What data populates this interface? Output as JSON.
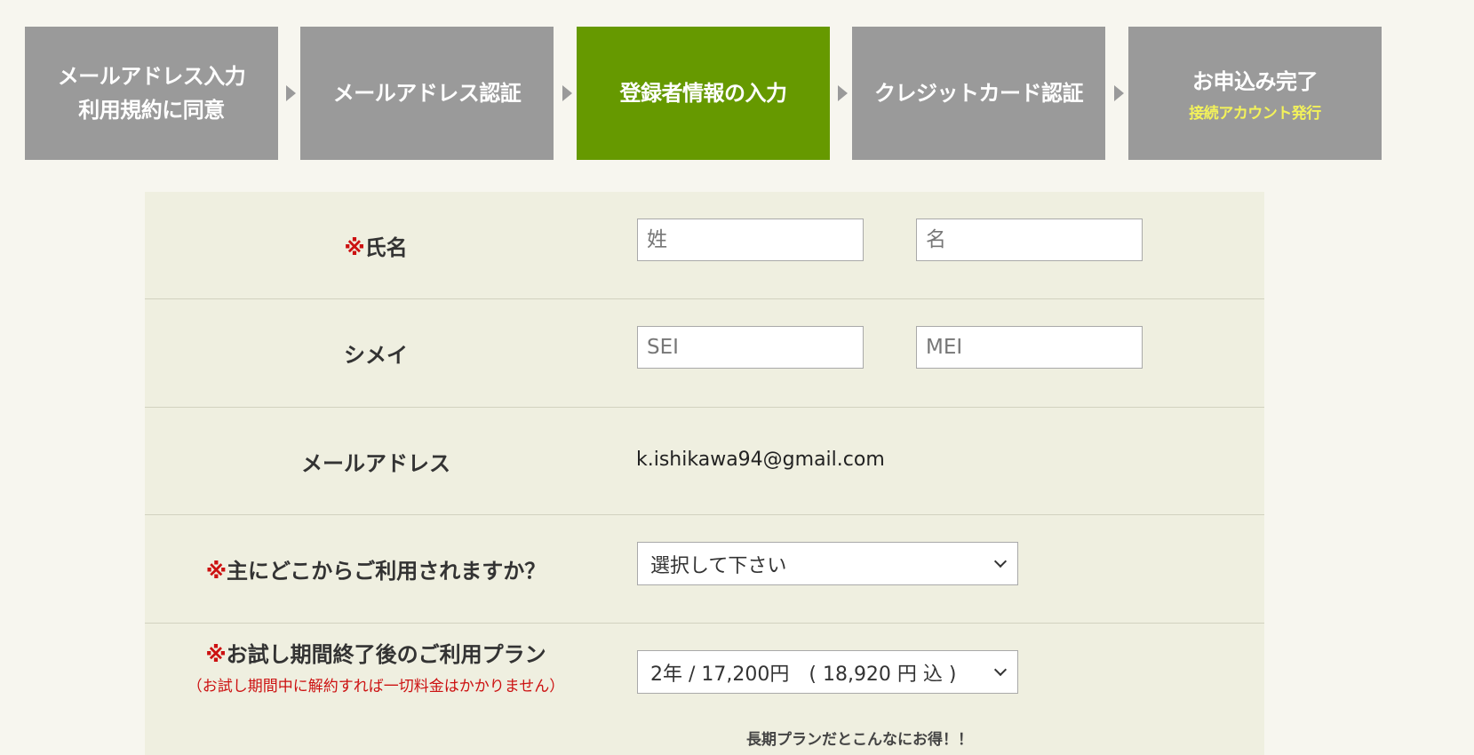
{
  "steps": [
    {
      "label": "メールアドレス入力\n利用規約に同意",
      "sub": ""
    },
    {
      "label": "メールアドレス認証",
      "sub": ""
    },
    {
      "label": "登録者情報の入力",
      "sub": ""
    },
    {
      "label": "クレジットカード認証",
      "sub": ""
    },
    {
      "label": "お申込み完了",
      "sub": "接続アカウント発行"
    }
  ],
  "colors": {
    "step_inactive": "#9a9a9a",
    "step_active": "#669900",
    "required_mark": "#cc1111",
    "form_bg": "#efefe0"
  },
  "form": {
    "required_mark": "※",
    "name": {
      "label": "氏名",
      "last_placeholder": "姓",
      "first_placeholder": "名"
    },
    "kana": {
      "label": "シメイ",
      "last_placeholder": "SEI",
      "first_placeholder": "MEI"
    },
    "email": {
      "label": "メールアドレス",
      "value": "k.ishikawa94@gmail.com"
    },
    "location": {
      "label": "主にどこからご利用されますか？",
      "selected": "選択して下さい"
    },
    "plan": {
      "label": "お試し期間終了後のご利用プラン",
      "note": "（お試し期間中に解約すれば一切料金はかかりません）",
      "selected": "2年 / 17,200円　( 18,920 円 込 )"
    },
    "promo": "長期プランだとこんなにお得！！"
  }
}
